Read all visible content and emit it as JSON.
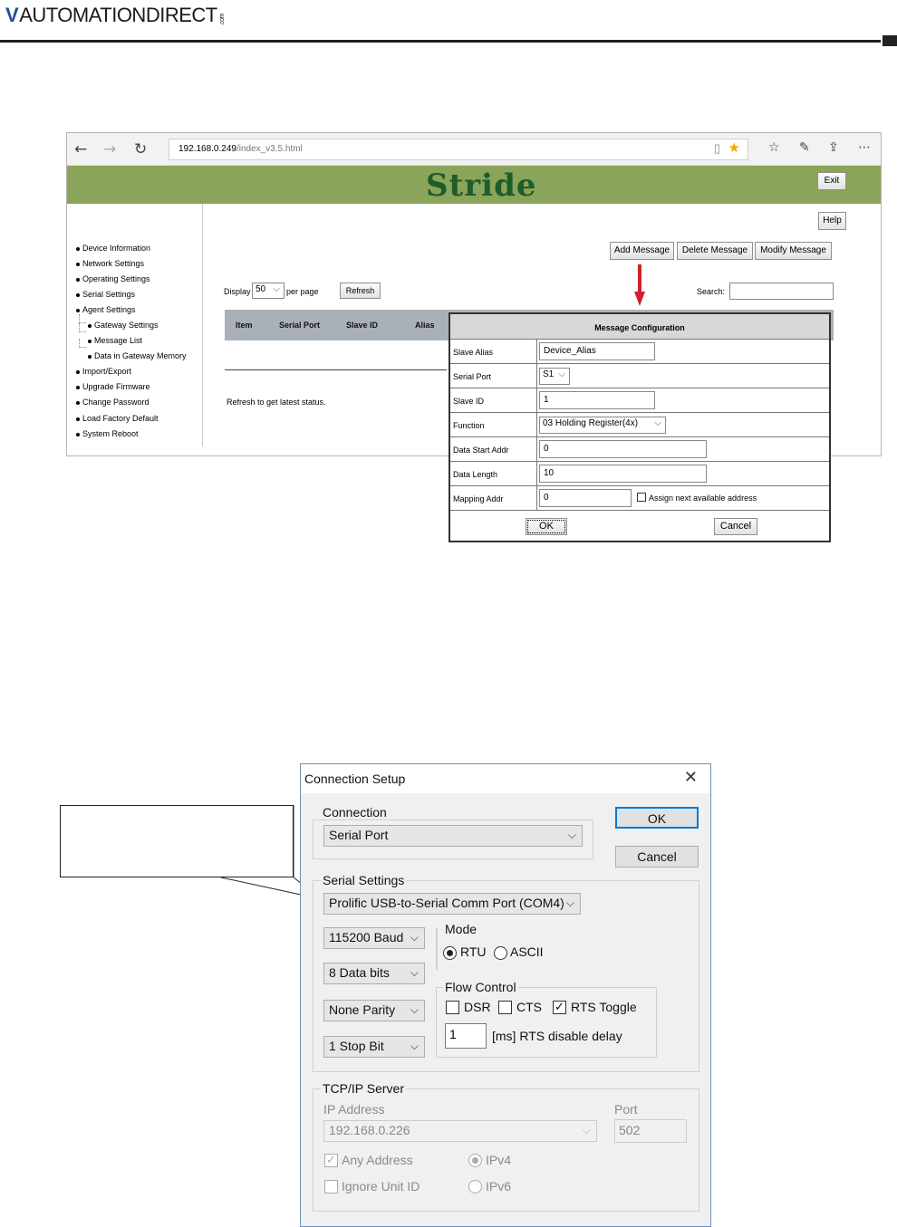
{
  "header": {
    "logo_text": "AUTOMATIONDIRECT",
    "logo_suffix": ".com"
  },
  "browser": {
    "url_host": "192.168.0.249",
    "url_path": "/index_v3.5.html",
    "brand": "Stride",
    "exit_label": "Exit",
    "help_label": "Help",
    "nav": [
      "Device Information",
      "Network Settings",
      "Operating Settings",
      "Serial Settings",
      "Agent Settings",
      "Gateway Settings",
      "Message List",
      "Data in Gateway Memory",
      "Import/Export",
      "Upgrade Firmware",
      "Change Password",
      "Load Factory Default",
      "System Reboot"
    ],
    "add_message": "Add Message",
    "delete_message": "Delete Message",
    "modify_message": "Modify Message",
    "display_label": "Display",
    "display_value": "50",
    "per_page": "per page",
    "refresh_label": "Refresh",
    "search_label": "Search:",
    "columns": [
      "Item",
      "Serial Port",
      "Slave ID",
      "Alias"
    ],
    "status_text": "Refresh to get latest status."
  },
  "msgcfg": {
    "title": "Message Configuration",
    "rows": [
      {
        "label": "Slave Alias",
        "value": "Device_Alias"
      },
      {
        "label": "Serial Port",
        "value": "S1"
      },
      {
        "label": "Slave ID",
        "value": "1"
      },
      {
        "label": "Function",
        "value": "03 Holding Register(4x)"
      },
      {
        "label": "Data Start Addr",
        "value": "0"
      },
      {
        "label": "Data Length",
        "value": "10"
      },
      {
        "label": "Mapping Addr",
        "value": "0"
      }
    ],
    "assign_next": "Assign next available address",
    "ok": "OK",
    "cancel": "Cancel"
  },
  "conn": {
    "title": "Connection Setup",
    "connection_group": "Connection",
    "connection_value": "Serial Port",
    "ok": "OK",
    "cancel": "Cancel",
    "serial_group": "Serial Settings",
    "port_value": "Prolific USB-to-Serial Comm Port (COM4)",
    "baud": "115200 Baud",
    "data_bits": "8 Data bits",
    "parity": "None Parity",
    "stop_bits": "1 Stop Bit",
    "mode_group": "Mode",
    "rtu": "RTU",
    "ascii": "ASCII",
    "flow_group": "Flow Control",
    "dsr": "DSR",
    "cts": "CTS",
    "rts_toggle": "RTS Toggle",
    "rts_delay_value": "1",
    "rts_delay_label": "[ms] RTS disable delay",
    "tcp_group": "TCP/IP Server",
    "ip_label": "IP Address",
    "ip_value": "192.168.0.226",
    "port_label": "Port",
    "port_num": "502",
    "any_address": "Any Address",
    "ipv4": "IPv4",
    "ignore_unit": "Ignore Unit ID",
    "ipv6": "IPv6"
  },
  "colors": {
    "banner": "#8aa45a",
    "stride": "#1e5d2a",
    "arrow": "#d0202a",
    "win_accent": "#0078d7"
  }
}
